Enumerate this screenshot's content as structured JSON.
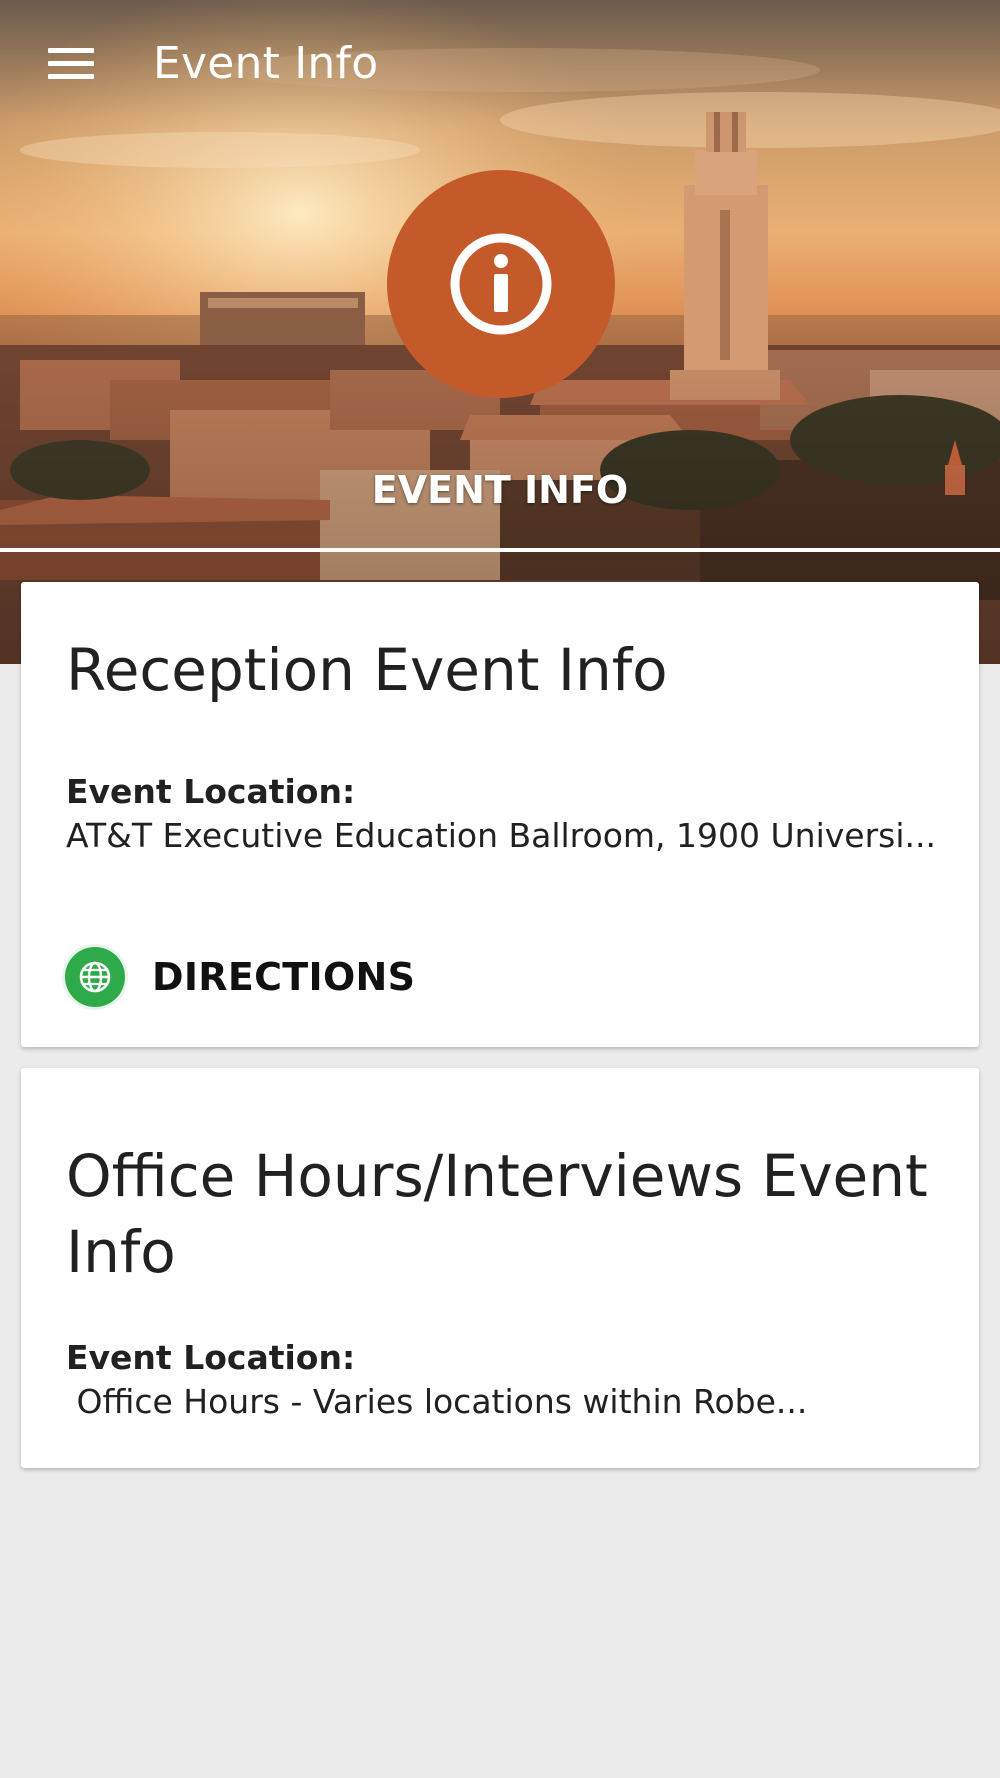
{
  "appbar": {
    "title": "Event Info",
    "menu_icon": "menu-icon"
  },
  "hero": {
    "badge_icon": "info-icon",
    "caption": "EVENT INFO",
    "badge_color": "#c45a2a"
  },
  "cards": [
    {
      "title": "Reception Event Info",
      "location_label": "Event Location:",
      "location_value": "AT&T Executive Education Ballroom, 1900 Universi...",
      "action_label": "DIRECTIONS",
      "action_icon": "globe-icon",
      "action_icon_color": "#2eaa4a"
    },
    {
      "title": "Office Hours/Interviews Event Info",
      "location_label": "Event Location:",
      "location_value": " Office Hours - Varies locations within Robe..."
    }
  ],
  "colors": {
    "background": "#ebebeb",
    "card": "#ffffff",
    "text": "#212121"
  }
}
